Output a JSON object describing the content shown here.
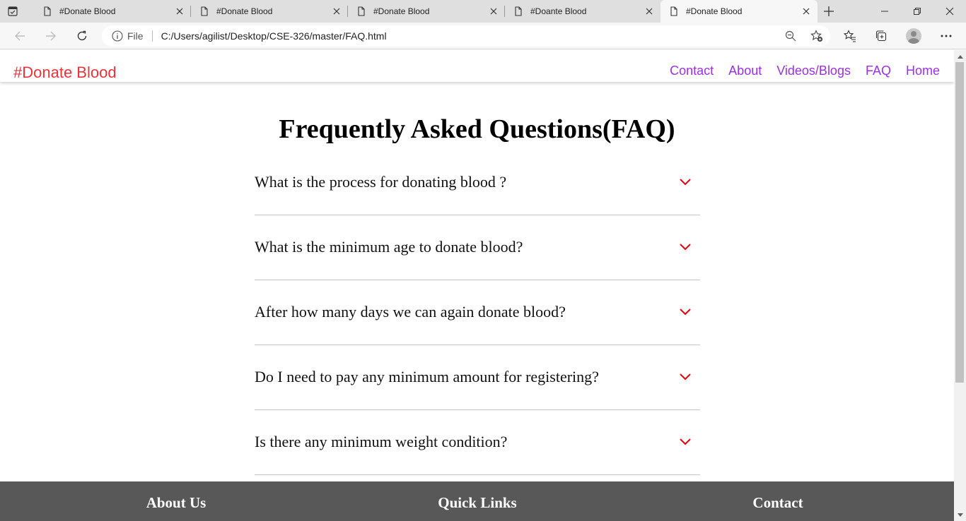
{
  "browser": {
    "tabs": [
      {
        "title": "#Donate Blood",
        "active": false
      },
      {
        "title": "#Donate Blood",
        "active": false
      },
      {
        "title": "#Donate Blood",
        "active": false
      },
      {
        "title": "#Doante Blood",
        "active": false
      },
      {
        "title": "#Donate Blood",
        "active": true
      }
    ],
    "address": {
      "scheme_label": "File",
      "url": "C:/Users/agilist/Desktop/CSE-326/master/FAQ.html"
    },
    "icons": {
      "tab_actions": "tab-actions-icon",
      "back": "back-arrow-icon",
      "forward": "forward-arrow-icon",
      "reload": "reload-icon",
      "info": "info-icon",
      "zoom": "zoom-out-icon",
      "add_favorite": "add-favorite-icon",
      "favorites": "favorites-icon",
      "collections": "collections-icon",
      "profile": "profile-avatar-icon",
      "more": "more-options-icon"
    }
  },
  "site": {
    "brand": "#Donate Blood",
    "brand_color": "#e8333b",
    "link_color": "#9b30e8",
    "nav": [
      "Contact",
      "About",
      "Videos/Blogs",
      "FAQ",
      "Home"
    ]
  },
  "faq": {
    "heading": "Frequently Asked Questions(FAQ)",
    "chevron_color": "#e8000b",
    "items": [
      "What is the process for donating blood ?",
      "What is the minimum age to donate blood?",
      "After how many days we can again donate blood?",
      "Do I need to pay any minimum amount for registering?",
      "Is there any minimum weight condition?"
    ]
  },
  "footer": {
    "background": "#585858",
    "columns": [
      "About Us",
      "Quick Links",
      "Contact"
    ]
  }
}
